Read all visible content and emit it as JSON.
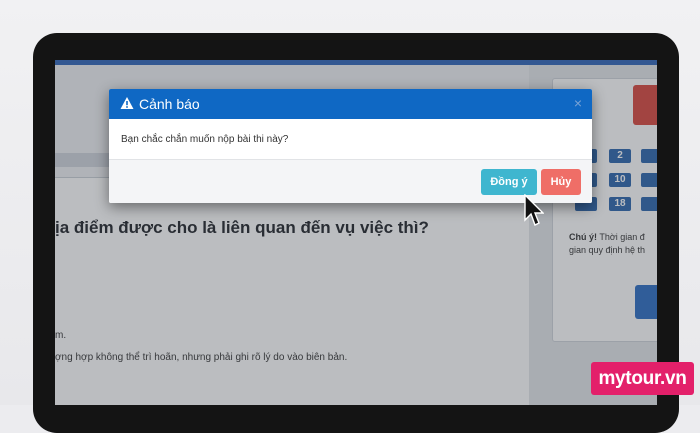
{
  "dialog": {
    "title": "Cảnh báo",
    "message": "Bạn chắc chắn muốn nộp bài thi này?",
    "close_glyph": "×",
    "confirm_label": "Đồng ý",
    "cancel_label": "Hủy"
  },
  "question": {
    "title": "ịa điểm được cho là liên quan đến vụ việc thì?",
    "option_1_fragment": "m.",
    "option_2_fragment": "ợng hợp không thể trì hoãn, nhưng phải ghi rõ lý do vào biên bản."
  },
  "question_nav": {
    "numbers": [
      "2",
      "10",
      "18"
    ]
  },
  "note": {
    "label": "Chú ý!",
    "text_line1": " Thời gian đ",
    "text_line2": "gian quy định hệ th"
  },
  "watermark": {
    "text": "mytour.vn"
  },
  "colors": {
    "dialog_header": "#0f68c4",
    "confirm_button": "#3fb6cf",
    "cancel_button": "#ef6e67",
    "question_button": "#2a64ad",
    "watermark_bg": "#e3206a"
  },
  "icons": {
    "dialog_title": "warning-triangle-icon",
    "pointer": "mouse-cursor-icon"
  }
}
